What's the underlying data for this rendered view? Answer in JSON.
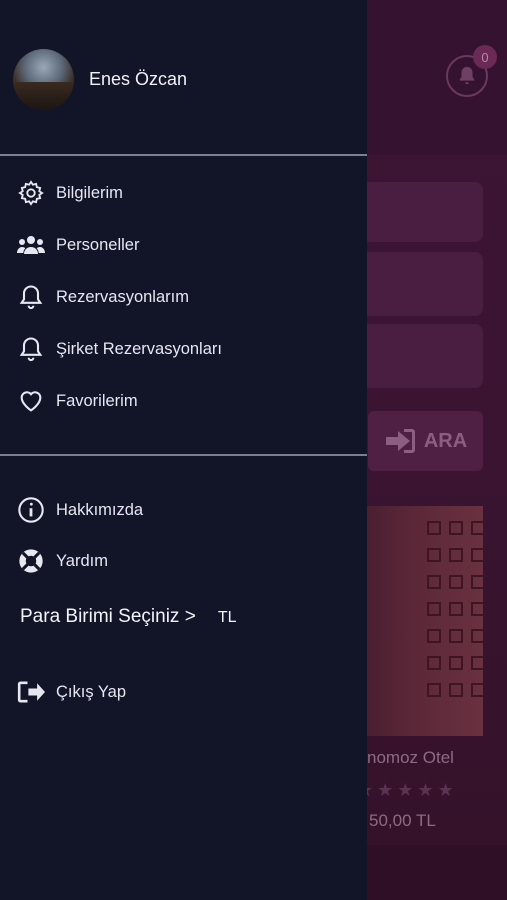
{
  "background": {
    "notification_count": "0",
    "search_button_label": "ARA",
    "hotel_name": "nomoz Otel",
    "hotel_price": "50,00  TL",
    "hotel_stars": "★★★★★"
  },
  "drawer": {
    "user_name": "Enes Özcan",
    "menu_primary": [
      {
        "label": "Bilgilerim",
        "icon": "gear-icon"
      },
      {
        "label": "Personeller",
        "icon": "users-icon"
      },
      {
        "label": "Rezervasyonlarım",
        "icon": "bell-icon"
      },
      {
        "label": "Şirket Rezervasyonları",
        "icon": "bell-icon"
      },
      {
        "label": "Favorilerim",
        "icon": "heart-icon"
      }
    ],
    "menu_secondary": [
      {
        "label": "Hakkımızda",
        "icon": "info-icon"
      },
      {
        "label": "Yardım",
        "icon": "lifebuoy-icon"
      }
    ],
    "currency_label": "Para Birimi Seçiniz >",
    "currency_value": "TL",
    "logout_label": "Çıkış Yap"
  },
  "colors": {
    "drawer_bg": "#121428",
    "background_tint": "#3a1530",
    "divider": "#7d7f8e"
  }
}
